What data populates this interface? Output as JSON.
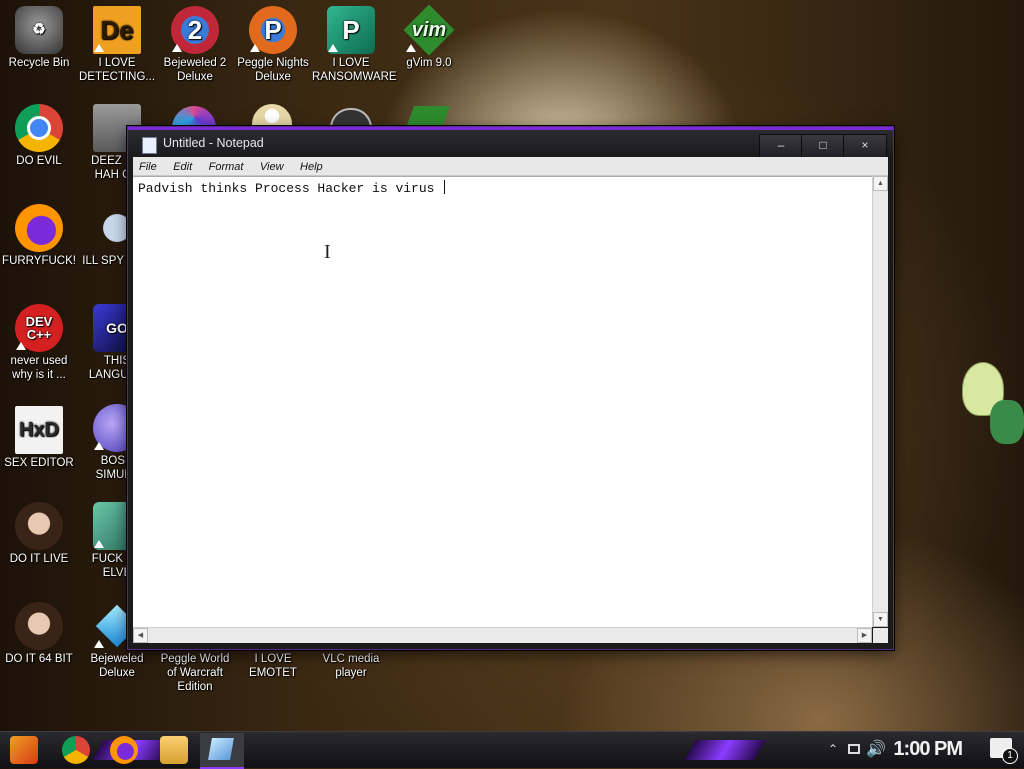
{
  "desktop_icons": [
    {
      "label": "Recycle Bin",
      "icon": "recycle-bin-icon",
      "color": "#555555"
    },
    {
      "label": "I LOVE DETECTING...",
      "icon": "de-icon",
      "color": "#f0a020"
    },
    {
      "label": "Bejeweled 2 Deluxe",
      "icon": "bejeweled-icon",
      "color": "#c0283a"
    },
    {
      "label": "Peggle Nights Deluxe",
      "icon": "peggle-icon",
      "color": "#e26a1c"
    },
    {
      "label": "I LOVE RANSOMWARE",
      "icon": "publisher-icon",
      "color": "#1b8a6c"
    },
    {
      "label": "gVim 9.0",
      "icon": "vim-icon",
      "color": "#2e8b2e"
    },
    {
      "label": "DO EVIL",
      "icon": "chrome-icon",
      "color": "#db4437"
    },
    {
      "label": "DEEZ N... HAH GC",
      "icon": "windows-icon",
      "color": "#7a7a7a"
    },
    {
      "label": "FURRYFUCK!",
      "icon": "firefox-icon",
      "color": "#e66000"
    },
    {
      "label": "ILL SPY YOU",
      "icon": "network-icon",
      "color": "#7a9ec8"
    },
    {
      "label": "never used why is it ...",
      "icon": "dev-cpp-icon",
      "color": "#d42020"
    },
    {
      "label": "THIS LANGUAG",
      "icon": "goland-icon",
      "color": "#3a3ad8"
    },
    {
      "label": "SEX EDITOR",
      "icon": "hxd-icon",
      "color": "#e8e8e8"
    },
    {
      "label": "BOSN SIMULA",
      "icon": "virus-icon",
      "color": "#6a5ad8"
    },
    {
      "label": "DO IT LIVE",
      "icon": "portrait-icon",
      "color": "#8a6a5a"
    },
    {
      "label": "FUCK SC ELVE",
      "icon": "game-icon",
      "color": "#4a9a8a"
    },
    {
      "label": "DO IT 64 BIT",
      "icon": "portrait-64-icon",
      "color": "#8a6a5a"
    },
    {
      "label": "Bejeweled Deluxe",
      "icon": "gem-icon",
      "color": "#28a8e8"
    },
    {
      "label": "Peggle World of Warcraft Edition",
      "icon": "",
      "color": ""
    },
    {
      "label": "I LOVE EMOTET",
      "icon": "",
      "color": ""
    },
    {
      "label": "VLC media player",
      "icon": "",
      "color": ""
    }
  ],
  "notepad": {
    "title": "Untitled - Notepad",
    "minimize": "–",
    "maximize": "□",
    "close": "×",
    "menu": [
      "File",
      "Edit",
      "Format",
      "View",
      "Help"
    ],
    "content": "Padvish thinks Process Hacker is virus "
  },
  "taskbar": {
    "clock": "1:00 PM",
    "notification_count": "1",
    "pinned": [
      "start-icon",
      "chrome-icon",
      "firefox-icon",
      "file-explorer-icon",
      "notepad-icon"
    ]
  },
  "colors": {
    "accent": "#8a3cff",
    "window_frame": "#1b1b1d"
  }
}
